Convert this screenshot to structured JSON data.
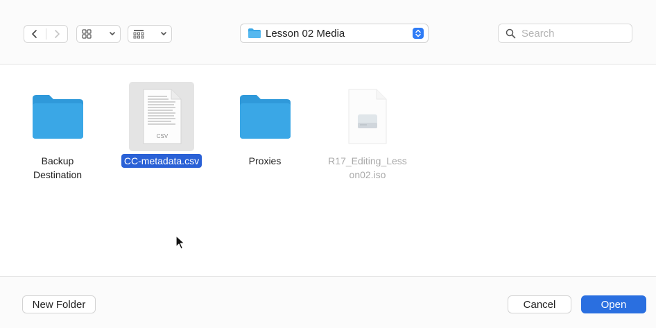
{
  "toolbar": {
    "back_icon": "chevron-left-icon",
    "forward_icon": "chevron-right-icon",
    "icon_view_icon": "grid-icon",
    "group_view_icon": "group-grid-icon",
    "location": "Lesson 02 Media",
    "search_placeholder": "Search"
  },
  "items": [
    {
      "label": "Backup\nDestination",
      "type": "folder"
    },
    {
      "label": "CC-metadata.csv",
      "type": "csv",
      "badge": "CSV",
      "selected": true
    },
    {
      "label": "Proxies",
      "type": "folder"
    },
    {
      "label": "R17_Editing_Less\non02.iso",
      "type": "disk-image",
      "disabled": true
    }
  ],
  "footer": {
    "new_folder": "New Folder",
    "cancel": "Cancel",
    "open": "Open"
  },
  "colors": {
    "folder": "#3aa7e6",
    "selection": "#2a61d6",
    "primary_button": "#2a6fe0"
  }
}
